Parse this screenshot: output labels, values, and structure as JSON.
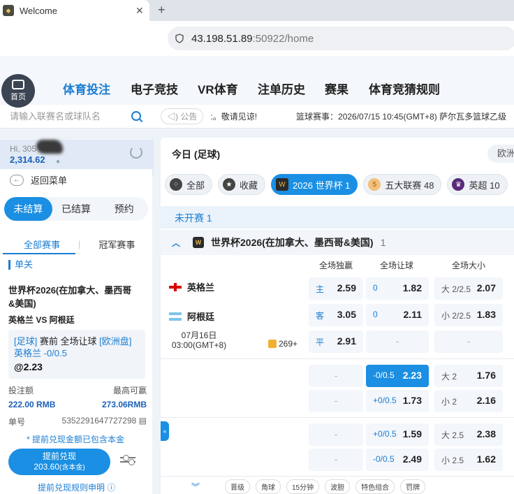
{
  "browser": {
    "tab_title": "Welcome",
    "url_host": "43.198.51.89",
    "url_rest": ":50922/home"
  },
  "nav": {
    "home": "首页",
    "items": [
      "体育投注",
      "电子竞技",
      "VR体育",
      "注单历史",
      "赛果",
      "体育竞猜规则"
    ]
  },
  "left": {
    "search_placeholder": "请输入联赛名或球队名",
    "hi": "Hi, 305",
    "balance": "2,314.62",
    "back": "返回菜单",
    "settle_tabs": [
      "未结算",
      "已结算",
      "预约"
    ],
    "sub_tabs": [
      "全部赛事",
      "冠军赛事"
    ],
    "single": "单关",
    "bet": {
      "league": "世界杯2026(在加拿大、墨西哥&美国)",
      "teams": "英格兰 VS 阿根廷",
      "type_tag": "[足球]",
      "type_text": " 赛前 全场让球 ",
      "market_tag": "[欧洲盘]",
      "selection": "英格兰 -0/0.5",
      "odds": "@2.23",
      "stake_label": "投注额",
      "stake": "222.00 RMB",
      "max_win_label": "最高可赢",
      "max_win": "273.06RMB",
      "order_label": "单号",
      "order_no": "5352291647727298"
    },
    "note": "* 提前兑现金额已包含本金",
    "cashout_label": "提前兑现",
    "cashout_value": "203.60",
    "cashout_suffix": "(含本金)",
    "rules": "提前兑现规则申明"
  },
  "announce": {
    "label": "公告",
    "msg1": ":。敬请见谅!",
    "msg2": "篮球赛事：2026/07/15 10:45(GMT+8) 萨尔瓦多篮球乙级"
  },
  "main": {
    "today": "今日 (足球)",
    "odds_format": "欧洲",
    "filters": [
      {
        "label": "全部",
        "icon": "grid-icon"
      },
      {
        "label": "收藏",
        "icon": "star-icon"
      },
      {
        "label": "2026 世界杯 1",
        "icon": "worldcup-icon"
      },
      {
        "label": "五大联赛 48",
        "icon": "five-leagues-icon"
      },
      {
        "label": "英超 10",
        "icon": "epl-icon"
      }
    ],
    "section": "未开赛 1",
    "league": "世界杯2026(在加拿大、墨西哥&美国)",
    "league_count": "1",
    "columns": [
      "全场独赢",
      "全场让球",
      "全场大小"
    ],
    "home": "英格兰",
    "away": "阿根廷",
    "date": "07月16日",
    "time": "03:00(GMT+8)",
    "more": "269+",
    "rows": [
      {
        "ml": [
          "主",
          "2.59"
        ],
        "hc": [
          "0",
          "1.82"
        ],
        "ou": [
          "大 2/2.5",
          "2.07"
        ]
      },
      {
        "ml": [
          "客",
          "3.05"
        ],
        "hc": [
          "0",
          "2.11"
        ],
        "ou": [
          "小 2/2.5",
          "1.83"
        ]
      },
      {
        "ml": [
          "平",
          "2.91"
        ],
        "hc": [
          "-",
          ""
        ],
        "ou": [
          "-",
          ""
        ]
      },
      {
        "ml": [
          "-",
          ""
        ],
        "hc": [
          "-0/0.5",
          "2.23"
        ],
        "ou": [
          "大 2",
          "1.76"
        ]
      },
      {
        "ml": [
          "-",
          ""
        ],
        "hc": [
          "+0/0.5",
          "1.73"
        ],
        "ou": [
          "小 2",
          "2.16"
        ]
      },
      {
        "ml": [
          "-",
          ""
        ],
        "hc": [
          "+0/0.5",
          "1.59"
        ],
        "ou": [
          "大 2.5",
          "2.38"
        ]
      },
      {
        "ml": [
          "-",
          ""
        ],
        "hc": [
          "-0/0.5",
          "2.49"
        ],
        "ou": [
          "小 2.5",
          "1.62"
        ]
      }
    ],
    "bottom_tags": [
      "晋级",
      "角球",
      "15分钟",
      "波胆",
      "特色组合",
      "罚牌"
    ]
  }
}
